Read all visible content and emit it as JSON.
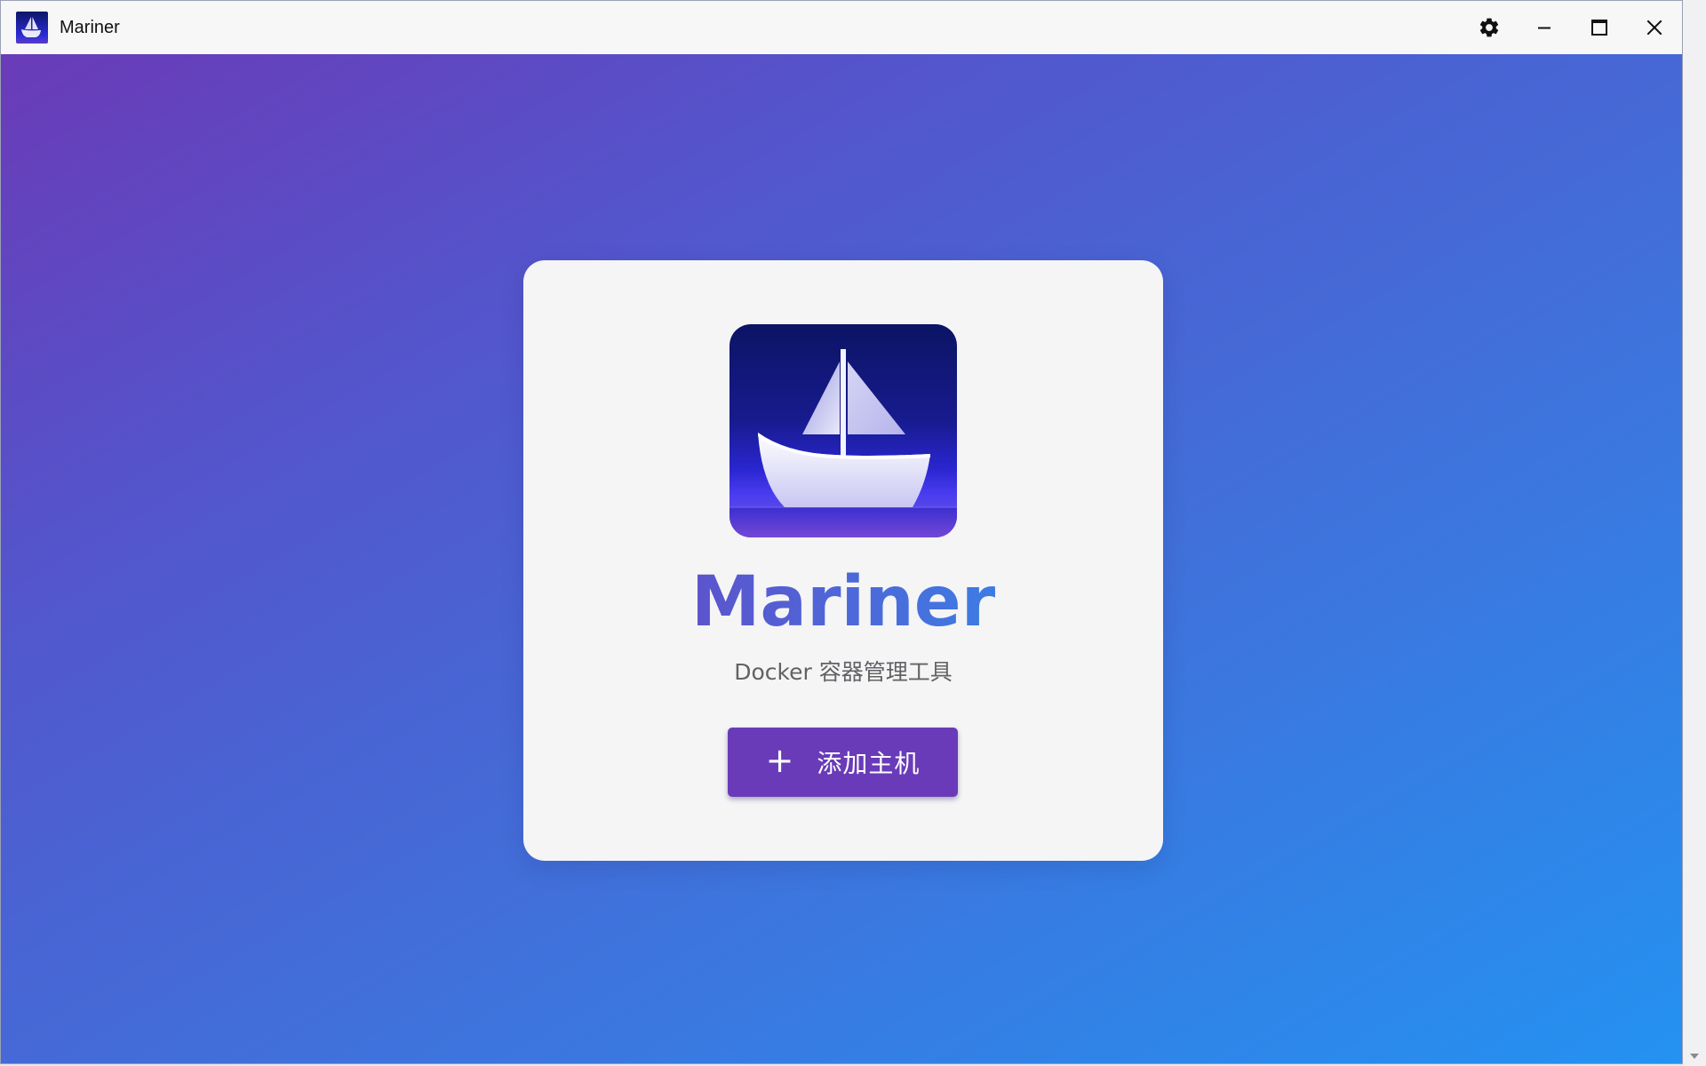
{
  "window": {
    "title": "Mariner",
    "app_icon": "sailboat-icon",
    "controls": [
      {
        "name": "settings",
        "icon": "gear-icon"
      },
      {
        "name": "minimize",
        "icon": "minimize-icon"
      },
      {
        "name": "maximize",
        "icon": "maximize-icon"
      },
      {
        "name": "close",
        "icon": "close-icon"
      }
    ]
  },
  "welcome": {
    "logo": "sailboat-logo",
    "app_name": "Mariner",
    "subtitle": "Docker 容器管理工具",
    "add_host_button": {
      "icon": "plus-icon",
      "label": "添加主机"
    }
  },
  "colors": {
    "brand_purple": "#6a3bb8",
    "gradient_start": "#6a3bb8",
    "gradient_end": "#2492f1",
    "card_background": "#f5f5f6",
    "logo_navy": "#0f1566"
  }
}
